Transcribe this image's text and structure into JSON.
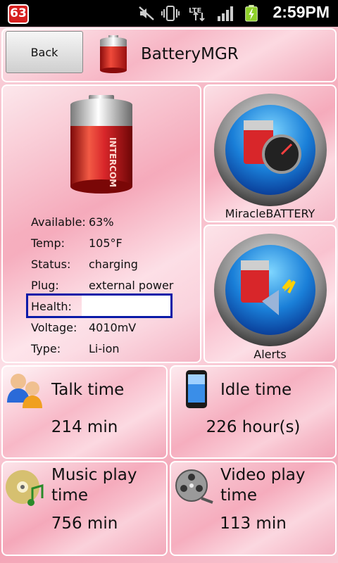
{
  "status_bar": {
    "notification_count": "63",
    "network": "LTE",
    "time": "2:59PM",
    "icons": [
      "mute-icon",
      "vibrate-icon",
      "lte-data-icon",
      "signal-icon",
      "battery-charging-icon"
    ]
  },
  "header": {
    "back_label": "Back",
    "app_title": "BatteryMGR"
  },
  "battery_info": {
    "rows": [
      {
        "label": "Available:",
        "value": "63%"
      },
      {
        "label": "Temp:",
        "value": "105°F"
      },
      {
        "label": "Status:",
        "value": "charging"
      },
      {
        "label": "Plug:",
        "value": "external power"
      },
      {
        "label": "Health:",
        "value": ""
      },
      {
        "label": "Voltage:",
        "value": "4010mV"
      },
      {
        "label": "Type:",
        "value": "Li-ion"
      }
    ],
    "battery_brand": "INTERCOM"
  },
  "shortcuts": {
    "miracle_label": "MiracleBATTERY",
    "alerts_label": "Alerts"
  },
  "stats": {
    "talk": {
      "title": "Talk time",
      "value": "214 min"
    },
    "idle": {
      "title": "Idle time",
      "value": "226 hour(s)"
    },
    "music": {
      "title_line1": "Music play",
      "title_line2": "time",
      "value": "756 min"
    },
    "video": {
      "title_line1": "Video play",
      "title_line2": "time",
      "value": "113 min"
    }
  },
  "colors": {
    "highlight_border": "#0a1aa8",
    "battery_red": "#d8262a",
    "status_bar_bg": "#000000"
  }
}
